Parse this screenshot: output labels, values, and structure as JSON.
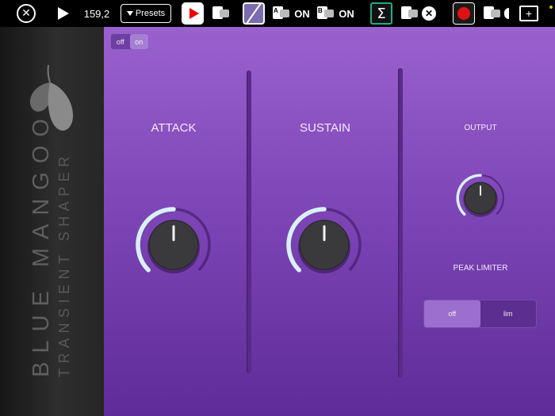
{
  "toolbar": {
    "tempo": "159,2",
    "presets_label": "Presets",
    "slot_a_state": "ON",
    "slot_b_state": "ON",
    "slot_a_letter": "A",
    "slot_b_letter": "B",
    "icons": [
      "close-icon",
      "play-icon",
      "app-icon-red",
      "plugin-icon",
      "app-icon-purple",
      "plugin-a-icon",
      "plugin-b-icon",
      "sigma-icon",
      "plugin-icon",
      "remove-icon",
      "app-icon-red-circle",
      "plugin-icon",
      "folder-add-icon"
    ]
  },
  "brand": {
    "name": "BLUE MANGOO",
    "subtitle": "TRANSIENT SHAPER"
  },
  "plugin": {
    "power": {
      "options": [
        "off",
        "on"
      ],
      "selected": "on"
    },
    "attack_label": "ATTACK",
    "sustain_label": "SUSTAIN",
    "output_label": "OUTPUT",
    "peak_limiter_label": "PEAK LIMITER",
    "limiter": {
      "options": [
        "off",
        "lim"
      ],
      "selected": "off"
    },
    "knobs": {
      "attack": 0.5,
      "sustain": 0.5,
      "output": 0.5
    }
  },
  "colors": {
    "accent": "#8b52c4",
    "knob_arc": "#d9f1f6",
    "panel_dark": "#262626"
  }
}
